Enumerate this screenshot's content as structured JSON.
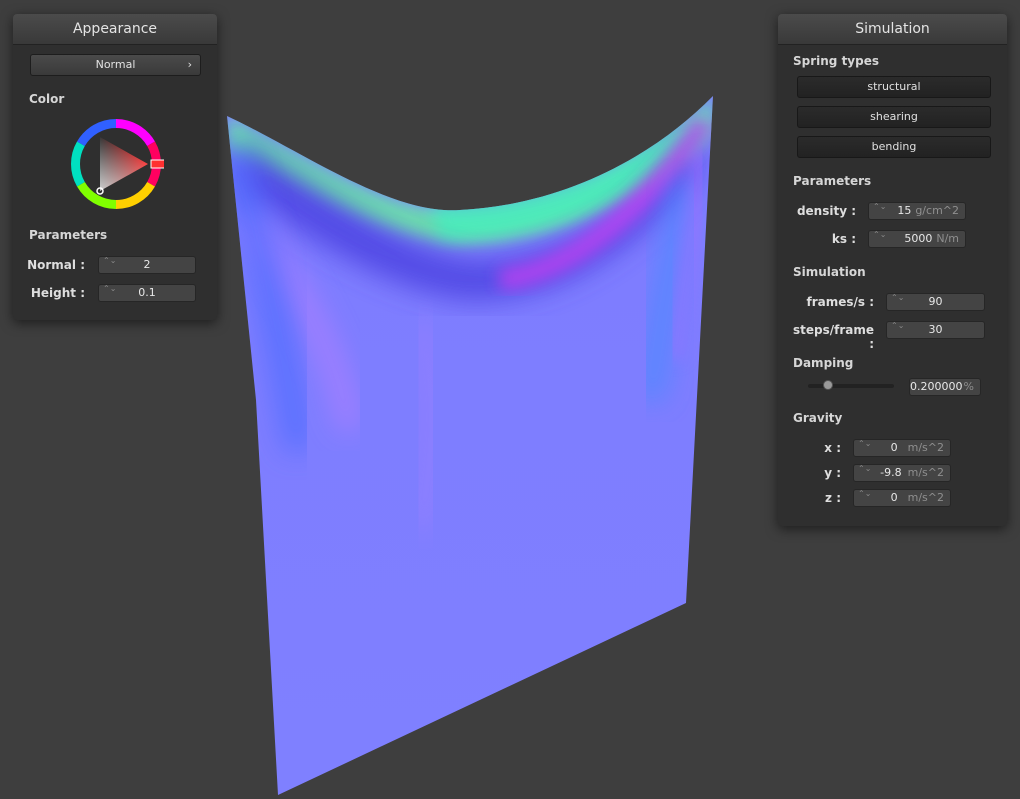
{
  "appearance": {
    "title": "Appearance",
    "mode_button": "Normal",
    "mode_chevron": "›",
    "color_label": "Color",
    "color_wheel_icon": "color-wheel-icon",
    "params_label": "Parameters",
    "normal_label": "Normal :",
    "normal_value": "2",
    "height_label": "Height :",
    "height_value": "0.1"
  },
  "simulation": {
    "title": "Simulation",
    "spring_types_label": "Spring types",
    "spring_buttons": [
      "structural",
      "shearing",
      "bending"
    ],
    "params_label": "Parameters",
    "density_label": "density :",
    "density_value": "15",
    "density_unit": "g/cm^2",
    "ks_label": "ks :",
    "ks_value": "5000",
    "ks_unit": "N/m",
    "sim_label": "Simulation",
    "fps_label": "frames/s :",
    "fps_value": "90",
    "steps_label": "steps/frame :",
    "steps_value": "30",
    "damping_label": "Damping",
    "damping_value": "0.200000",
    "damping_unit": "%",
    "damping_level": 0.2,
    "gravity_label": "Gravity",
    "gx_label": "x :",
    "gx_value": "0",
    "gy_label": "y :",
    "gy_value": "-9.8",
    "gz_label": "z :",
    "gz_value": "0",
    "g_unit": "m/s^2"
  },
  "spin_glyph": "⌃⌄",
  "colors": {
    "background": "#3e3e3e",
    "panel": "#2f2f2f",
    "cloth_base": "#7f7fff",
    "wheel_selected": "#ff2020"
  }
}
